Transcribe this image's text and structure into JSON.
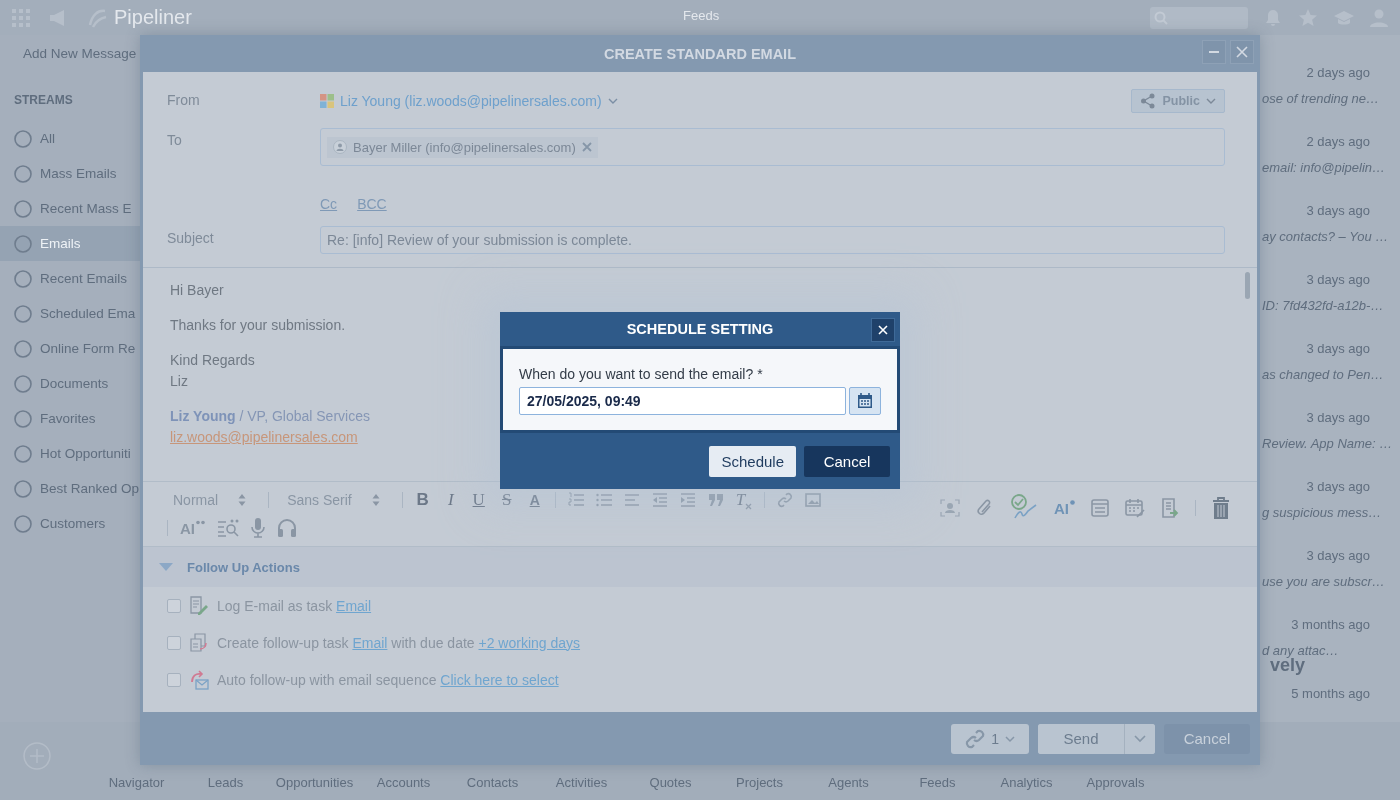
{
  "top_bar": {
    "app_name": "Pipeliner",
    "title": "Feeds"
  },
  "sidebar": {
    "add_button": "Add New Message",
    "section_title": "STREAMS",
    "items": [
      {
        "label": "All",
        "selected": false
      },
      {
        "label": "Mass Emails",
        "selected": false
      },
      {
        "label": "Recent Mass E",
        "selected": false
      },
      {
        "label": "Emails",
        "selected": true
      },
      {
        "label": "Recent Emails",
        "selected": false
      },
      {
        "label": "Scheduled Ema",
        "selected": false
      },
      {
        "label": "Online Form Re",
        "selected": false
      },
      {
        "label": "Documents",
        "selected": false
      },
      {
        "label": "Favorites",
        "selected": false
      },
      {
        "label": "Hot Opportuniti",
        "selected": false
      },
      {
        "label": "Best Ranked Op",
        "selected": false
      },
      {
        "label": "Customers",
        "selected": false
      }
    ]
  },
  "feed": {
    "items": [
      {
        "time": "2 days ago",
        "snippet": "ose of trending ne…"
      },
      {
        "time": "2 days ago",
        "snippet": "email: info@pipelin…"
      },
      {
        "time": "3 days ago",
        "snippet": "ay contacts? – You …"
      },
      {
        "time": "3 days ago",
        "snippet": "ID: 7fd432fd-a12b-…"
      },
      {
        "time": "3 days ago",
        "snippet": "as changed to Pen…"
      },
      {
        "time": "3 days ago",
        "snippet": "Review. App Name: …"
      },
      {
        "time": "3 days ago",
        "snippet": "g suspicious mess…"
      },
      {
        "time": "3 days ago",
        "snippet": "use you are subscr…"
      },
      {
        "time": "3 months ago",
        "snippet": "d any attac…"
      },
      {
        "time": "5 months ago"
      }
    ],
    "promo_text": "vely"
  },
  "bottom_nav": {
    "items": [
      "Navigator",
      "Leads",
      "Opportunities",
      "Accounts",
      "Contacts",
      "Activities",
      "Quotes",
      "Projects",
      "Agents",
      "Feeds",
      "Analytics",
      "Approvals"
    ]
  },
  "email_dialog": {
    "title": "CREATE STANDARD EMAIL",
    "from_label": "From",
    "from_value": "Liz Young (liz.woods@pipelinersales.com)",
    "visibility": "Public",
    "to_label": "To",
    "recipients": [
      "Bayer Miller (info@pipelinersales.com)"
    ],
    "cc": "Cc",
    "bcc": "BCC",
    "subject_label": "Subject",
    "subject": "Re: [info] Review of your submission is complete.",
    "body": {
      "paragraphs": [
        [
          "Hi Bayer"
        ],
        [
          "Thanks for your submission."
        ],
        [
          "Kind Regards",
          "Liz"
        ]
      ],
      "signature": "**Liz Young** / VP, Global Services",
      "signature_email": "liz.woods@pipelinersales.com"
    },
    "toolbar": {
      "paragraph_style": "Normal",
      "font": "Sans Serif",
      "format_buttons": [
        {
          "kind": "bold",
          "glyph": "B"
        },
        {
          "kind": "italic",
          "glyph": "I"
        },
        {
          "kind": "underline",
          "glyph": "U"
        },
        {
          "kind": "strike",
          "glyph": "S"
        },
        {
          "kind": "color",
          "glyph": "A"
        }
      ],
      "clear_glyph": "T",
      "ai_glyph": "AI",
      "ai_side_glyph": "AI"
    },
    "follow_up": {
      "title": "Follow Up Actions",
      "expanded": true,
      "items": [
        {
          "checked": false,
          "parts": [
            {
              "kind": "text",
              "text": "Log E-mail as task "
            },
            {
              "kind": "link",
              "text": "Email"
            }
          ]
        },
        {
          "checked": false,
          "parts": [
            {
              "kind": "text",
              "text": "Create follow-up task "
            },
            {
              "kind": "link",
              "text": "Email"
            },
            {
              "kind": "text",
              "text": " with due date "
            },
            {
              "kind": "link",
              "text": "+2 working days"
            }
          ]
        },
        {
          "checked": false,
          "parts": [
            {
              "kind": "text",
              "text": "Auto follow-up with email sequence "
            },
            {
              "kind": "link",
              "text": "Click here to select"
            }
          ]
        }
      ]
    },
    "footer": {
      "attachment_count": "1",
      "send": "Send",
      "cancel": "Cancel"
    }
  },
  "schedule_dialog": {
    "title": "SCHEDULE SETTING",
    "question": "When do you want to send the email? *",
    "value": "27/05/2025, 09:49",
    "schedule_button": "Schedule",
    "cancel_button": "Cancel"
  }
}
